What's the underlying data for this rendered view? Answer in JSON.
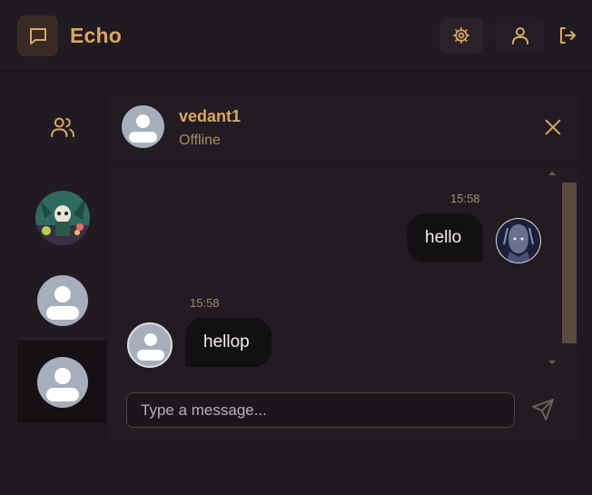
{
  "header": {
    "app_title": "Echo",
    "logo_icon": "message-square-icon",
    "settings_icon": "gear-icon",
    "profile_icon": "user-icon",
    "logout_icon": "logout-icon",
    "accent_color": "#d9a860"
  },
  "sidebar": {
    "header_icon": "users-icon",
    "contacts": [
      {
        "avatar": "illustrated-character"
      },
      {
        "avatar": "default-user"
      },
      {
        "avatar": "default-user",
        "active": true
      }
    ]
  },
  "chat": {
    "contact_name": "vedant1",
    "status": "Offline",
    "close_icon": "close-icon",
    "messages": [
      {
        "direction": "outgoing",
        "time": "15:58",
        "text": "hello",
        "avatar": "illustrated-portrait"
      },
      {
        "direction": "incoming",
        "time": "15:58",
        "text": "hellop",
        "avatar": "default-user"
      }
    ]
  },
  "composer": {
    "placeholder": "Type a message...",
    "value": "",
    "send_icon": "send-icon"
  }
}
